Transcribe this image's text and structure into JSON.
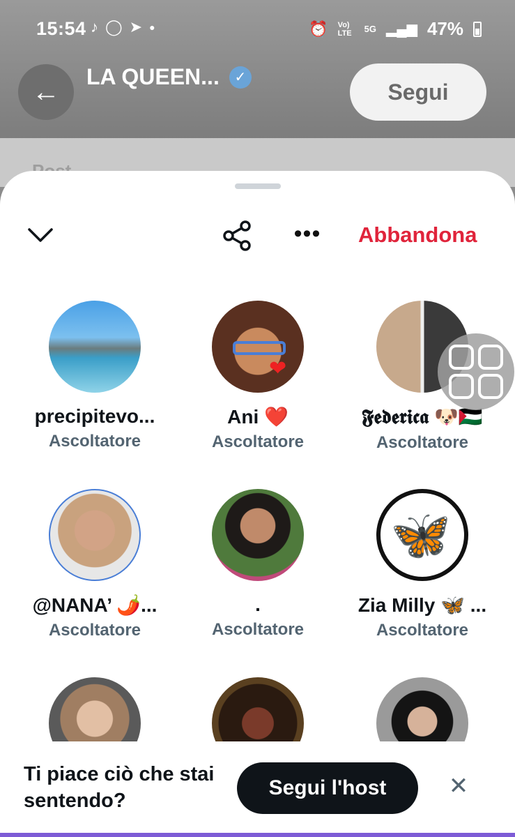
{
  "status": {
    "time": "15:54",
    "battery": "47%",
    "network": "5G",
    "volte": "Vo) LTE"
  },
  "header": {
    "title": "LA QUEEN...",
    "follow_label": "Segui"
  },
  "background_tabs": {
    "post_label": "Post"
  },
  "sheet": {
    "leave_label": "Abbandona"
  },
  "participants": [
    {
      "name": "precipitevo...",
      "role": "Ascoltatore"
    },
    {
      "name": "Ani ❤️",
      "role": "Ascoltatore"
    },
    {
      "name": "𝕱𝖊𝖉𝖊𝖗𝖎𝖈𝖆 🐶🇵🇸",
      "role": "Ascoltatore"
    },
    {
      "name": "@NANA’ 🌶️...",
      "role": "Ascoltatore"
    },
    {
      "name": ".",
      "role": "Ascoltatore"
    },
    {
      "name": "Zia Milly 🦋 ...",
      "role": "Ascoltatore"
    }
  ],
  "cta": {
    "question": "Ti piace ciò che stai sentendo?",
    "button": "Segui l'host"
  },
  "colors": {
    "accent_red": "#e0243b",
    "text_primary": "#0f1419",
    "text_secondary": "#536471",
    "verified_blue": "#6aa4d8"
  }
}
